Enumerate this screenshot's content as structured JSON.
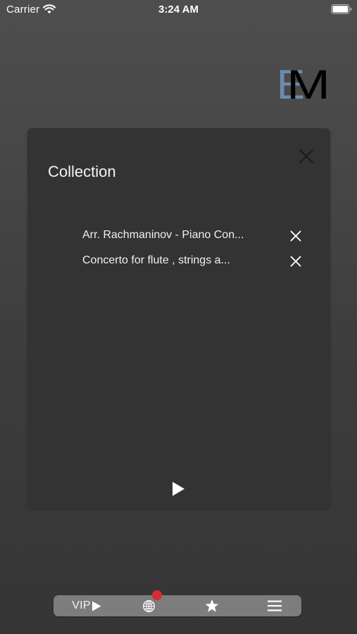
{
  "status_bar": {
    "carrier": "Carrier",
    "time": "3:24 AM",
    "wifi_icon": "wifi-icon",
    "battery_icon": "battery-full-icon"
  },
  "logo": {
    "letters": "EM",
    "back_letter_color": "#6c8cb0",
    "front_letter_color": "#000000"
  },
  "collection": {
    "title": "Collection",
    "close_icon": "close-icon",
    "items": [
      {
        "title": "Arr. Rachmaninov - Piano Con...",
        "remove_icon": "remove-icon"
      },
      {
        "title": "Concerto for flute , strings a...",
        "remove_icon": "remove-icon"
      }
    ],
    "play_icon": "play-icon"
  },
  "toolbar": {
    "vip_label": "VIP",
    "vip_icon": "play-icon",
    "globe_icon": "globe-icon",
    "notification_dot_color": "#d52d37",
    "star_icon": "star-icon",
    "menu_icon": "menu-icon"
  },
  "colors": {
    "background": "#444444",
    "panel": "#333333",
    "toolbar": "#7d7d7d",
    "text": "#ffffff"
  }
}
